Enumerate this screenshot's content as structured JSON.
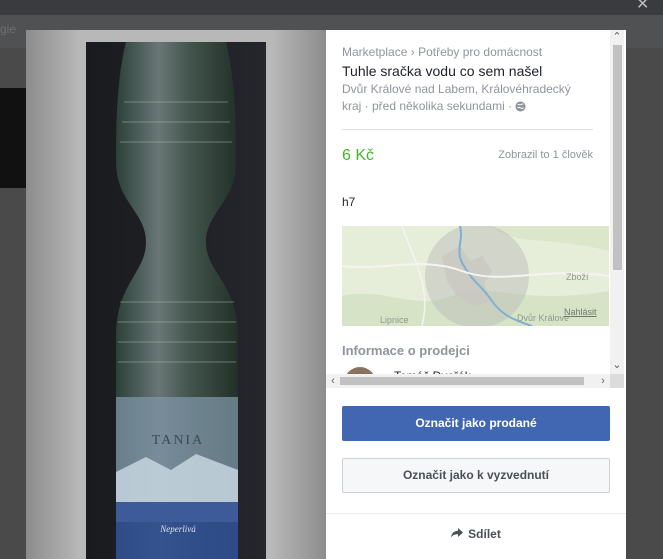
{
  "background": {
    "nav_text": "gie"
  },
  "listing": {
    "breadcrumb_root": "Marketplace",
    "breadcrumb_sep": "›",
    "breadcrumb_category": "Potřeby pro domácnost",
    "title": "Tuhle sračka vodu co sem našel",
    "location_line1": "Dvůr Králové nad Labem, Královéhradecký",
    "location_line2": "kraj · před několika sekundami · ",
    "privacy_icon": "globe-icon",
    "price": "6 Kč",
    "price_color": "#42b72a",
    "views": "Zobrazil to 1 člověk",
    "description": "h7",
    "map": {
      "labels": [
        "Zboží",
        "Lipnice",
        "Dvůr Králové",
        "Nahlásit"
      ]
    },
    "seller_heading": "Informace o prodejci",
    "seller_name": "Tomáš Dvořák"
  },
  "photo": {
    "bottle_label": "TANIA",
    "bottle_sublabel": "Neperlivá"
  },
  "actions": {
    "mark_sold": "Označit jako prodané",
    "mark_pickup": "Označit jako k vyzvednutí",
    "share": "Sdílet",
    "accent": "#4267b2"
  }
}
